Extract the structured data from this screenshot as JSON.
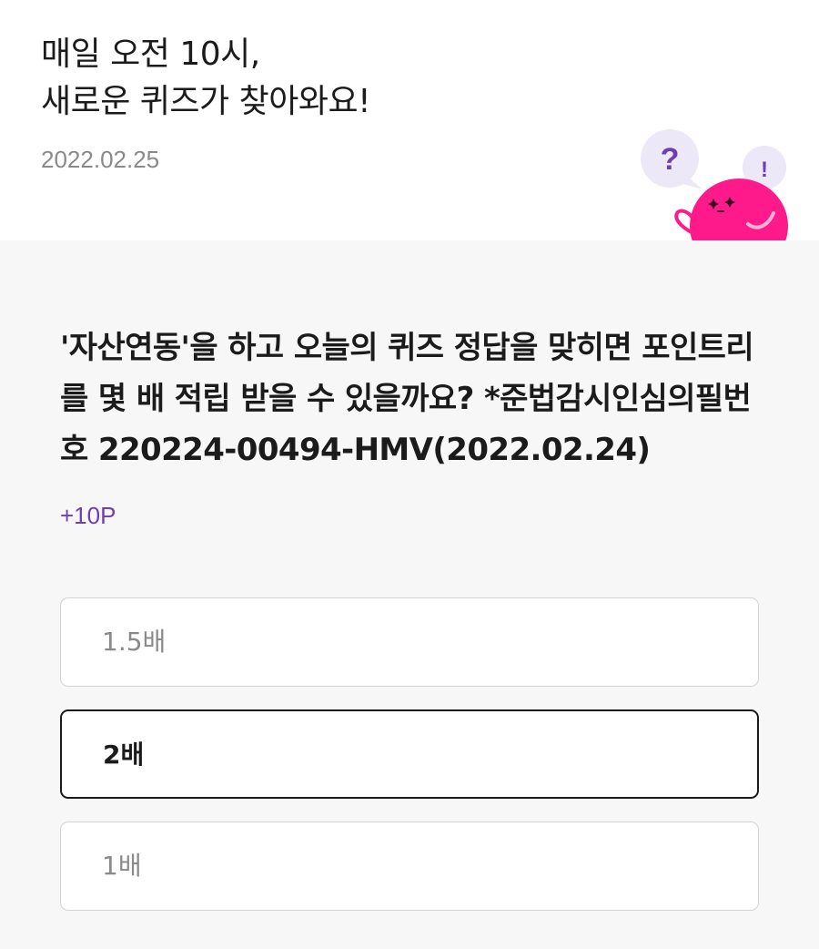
{
  "header": {
    "title_line1": "매일 오전 10시,",
    "title_line2": "새로운 퀴즈가 찾아와요!",
    "date": "2022.02.25",
    "mascot": {
      "question_mark": "?",
      "exclamation_mark": "!",
      "icon": "pink-blob-mascot-icon"
    }
  },
  "quiz": {
    "question": "'자산연동'을 하고 오늘의 퀴즈 정답을 맞히면 포인트리를 몇 배 적립 받을 수 있을까요? *준법감시인심의필번호 220224-00494-HMV(2022.02.24)",
    "reward": "+10P",
    "options": [
      {
        "label": "1.5배",
        "selected": false
      },
      {
        "label": "2배",
        "selected": true
      },
      {
        "label": "1배",
        "selected": false
      }
    ]
  },
  "colors": {
    "accent_purple": "#6c3fb5",
    "mascot_pink": "#ff1a8c",
    "bubble_lavender": "#ede8f7",
    "page_background": "#f7f7f7",
    "selected_border": "#1b1b1b"
  }
}
